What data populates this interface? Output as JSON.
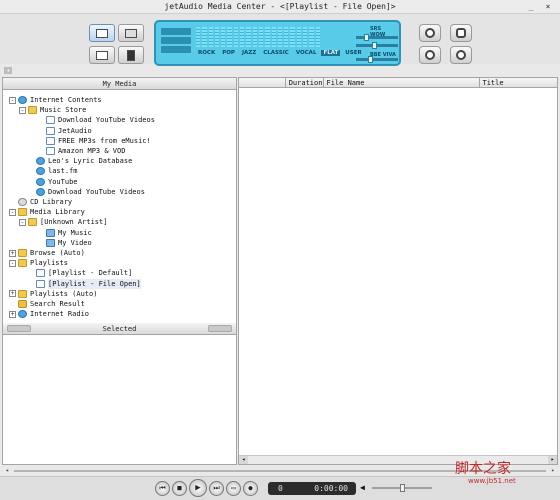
{
  "window": {
    "title": "jetAudio Media Center - <[Playlist - File Open]>",
    "minimize_glyph": "_",
    "close_glyph": "×"
  },
  "lcd": {
    "presets": [
      "ROCK",
      "POP",
      "JAZZ",
      "CLASSIC",
      "VOCAL",
      "FLAT",
      "USER"
    ],
    "selected_preset": "FLAT",
    "labels": [
      "SRS WOW",
      "BBE VIVA"
    ]
  },
  "left_panel": {
    "title": "My Media",
    "tree": [
      {
        "label": "Internet Contents",
        "icon": "globe-icon",
        "expander": "-"
      },
      {
        "label": "Music Store",
        "icon": "folder-icon",
        "expander": "-"
      },
      {
        "label": "Download YouTube Videos",
        "icon": "document-icon",
        "expander": ""
      },
      {
        "label": "JetAudio",
        "icon": "document-icon",
        "expander": ""
      },
      {
        "label": "FREE MP3s from eMusic!",
        "icon": "document-icon",
        "expander": ""
      },
      {
        "label": "Amazon MP3 & VOD",
        "icon": "document-icon",
        "expander": ""
      },
      {
        "label": "Leo's Lyric Database",
        "icon": "globe-icon",
        "expander": ""
      },
      {
        "label": "last.fm",
        "icon": "globe-icon",
        "expander": ""
      },
      {
        "label": "YouTube",
        "icon": "globe-icon",
        "expander": ""
      },
      {
        "label": "Download YouTube Videos",
        "icon": "globe-icon",
        "expander": ""
      },
      {
        "label": "CD Library",
        "icon": "cd-icon",
        "expander": ""
      },
      {
        "label": "Media Library",
        "icon": "folder-icon",
        "expander": "-"
      },
      {
        "label": "[Unknown Artist]",
        "icon": "folder-icon",
        "expander": "-"
      },
      {
        "label": "My Music",
        "icon": "music-note-icon",
        "expander": ""
      },
      {
        "label": "My Video",
        "icon": "music-note-icon",
        "expander": ""
      },
      {
        "label": "Browse (Auto)",
        "icon": "folder-icon",
        "expander": "+"
      },
      {
        "label": "Playlists",
        "icon": "folder-icon",
        "expander": "-"
      },
      {
        "label": "[Playlist - Default]",
        "icon": "playlist-icon",
        "expander": ""
      },
      {
        "label": "[Playlist - File Open]",
        "icon": "playlist-icon",
        "expander": ""
      },
      {
        "label": "Playlists (Auto)",
        "icon": "folder-icon",
        "expander": "+"
      },
      {
        "label": "Search Result",
        "icon": "search-icon",
        "expander": ""
      },
      {
        "label": "Internet Radio",
        "icon": "globe-icon",
        "expander": "+"
      }
    ],
    "selected_title": "Selected"
  },
  "right_panel": {
    "columns": [
      "",
      "Duration",
      "File Name",
      "Title"
    ]
  },
  "transport": {
    "elapsed": "0",
    "time": "0:00:00"
  },
  "watermark": {
    "text": "脚本之家",
    "url": "www.jb51.net"
  }
}
